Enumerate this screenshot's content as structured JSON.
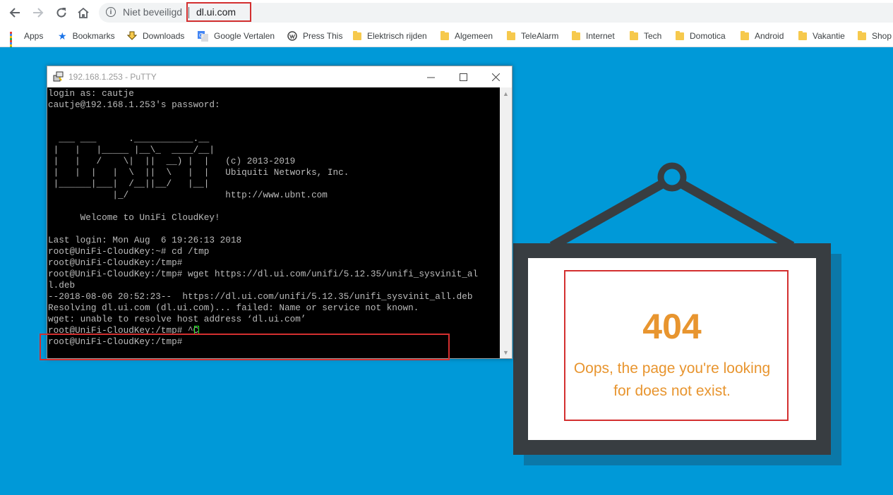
{
  "browser": {
    "security_label": "Niet beveiligd",
    "url": "dl.ui.com",
    "bookmarks": [
      {
        "label": "Apps",
        "icon": "apps-grid-icon"
      },
      {
        "label": "Bookmarks",
        "icon": "star-icon"
      },
      {
        "label": "Downloads",
        "icon": "download-icon"
      },
      {
        "label": "Google Vertalen",
        "icon": "google-translate-icon"
      },
      {
        "label": "Press This",
        "icon": "wordpress-icon"
      },
      {
        "label": "Elektrisch rijden",
        "icon": "folder-icon"
      },
      {
        "label": "Algemeen",
        "icon": "folder-icon"
      },
      {
        "label": "TeleAlarm",
        "icon": "folder-icon"
      },
      {
        "label": "Internet",
        "icon": "folder-icon"
      },
      {
        "label": "Tech",
        "icon": "folder-icon"
      },
      {
        "label": "Domotica",
        "icon": "folder-icon"
      },
      {
        "label": "Android",
        "icon": "folder-icon"
      },
      {
        "label": "Vakantie",
        "icon": "folder-icon"
      },
      {
        "label": "Shop",
        "icon": "folder-icon"
      }
    ]
  },
  "putty": {
    "title": "192.168.1.253 - PuTTY",
    "terminal_text": "login as: cautje\ncautje@192.168.1.253's password:\n\n\n  ___ ___      .___________.__\n |   |   |_____ |__\\_  ____/__|\n |   |   /    \\|  ||  __) |  |   (c) 2013-2019\n |   |  |   |  \\  ||  \\   |  |   Ubiquiti Networks, Inc.\n |______|___|  /__||__/   |__|\n            |_/                  http://www.ubnt.com\n\n      Welcome to UniFi CloudKey!\n\nLast login: Mon Aug  6 19:26:13 2018\nroot@UniFi-CloudKey:~# cd /tmp\nroot@UniFi-CloudKey:/tmp#\nroot@UniFi-CloudKey:/tmp# wget https://dl.ui.com/unifi/5.12.35/unifi_sysvinit_al\nl.deb\n--2018-08-06 20:52:23--  https://dl.ui.com/unifi/5.12.35/unifi_sysvinit_all.deb\nResolving dl.ui.com (dl.ui.com)... failed: Name or service not known.\nwget: unable to resolve host address ‘dl.ui.com’\nroot@UniFi-CloudKey:/tmp# ^C\nroot@UniFi-CloudKey:/tmp# "
  },
  "error_page": {
    "code": "404",
    "message": "Oops, the page you're looking for does not exist."
  },
  "colors": {
    "page_background": "#0099d8",
    "sign_frame": "#383d41",
    "error_text": "#e8952f",
    "highlight": "#d32f2f",
    "terminal_text": "#bbbbbb",
    "cursor": "#22ee22"
  }
}
